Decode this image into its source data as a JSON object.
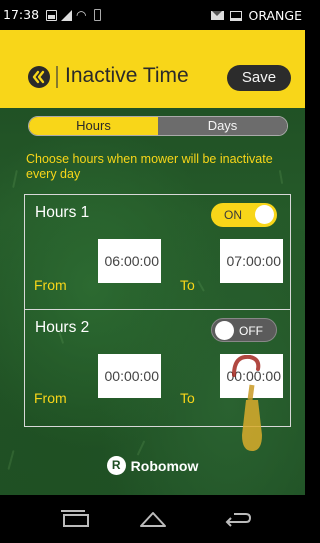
{
  "status_bar": {
    "time": "17:38",
    "carrier": "ORANGE"
  },
  "header": {
    "title": "Inactive Time",
    "save_label": "Save"
  },
  "segment": {
    "hours_label": "Hours",
    "days_label": "Days",
    "selected": "Hours"
  },
  "instruction": "Choose hours when mower will be inactivate every day",
  "ranges": [
    {
      "title": "Hours 1",
      "toggle_label": "ON",
      "enabled": true,
      "from_label": "From",
      "from_value": "06:00:00",
      "to_label": "To",
      "to_value": "07:00:00"
    },
    {
      "title": "Hours 2",
      "toggle_label": "OFF",
      "enabled": false,
      "from_label": "From",
      "from_value": "00:00:00",
      "to_label": "To",
      "to_value": "00:00:00"
    }
  ],
  "brand": {
    "logo_letter": "R",
    "name": "Robomow"
  },
  "colors": {
    "accent": "#f8d619",
    "header_bg": "#f8d619",
    "button_dark": "#2c2c2c"
  },
  "icons": {
    "back": "back-icon",
    "nav_recent": "recent-apps-icon",
    "nav_home": "home-icon",
    "nav_back": "nav-back-icon"
  }
}
